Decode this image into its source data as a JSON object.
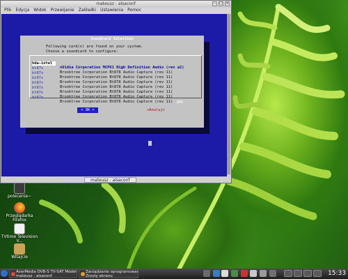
{
  "terminal": {
    "title": "mateusz : alsaconf",
    "menu": [
      "Plik",
      "Edycja",
      "Widok",
      "Przewijanie",
      "Zakładki",
      "Ustawienia",
      "Pomoc"
    ],
    "tab_label": "mateusz : alsaconf"
  },
  "dialog": {
    "title": "Soundcard Selection",
    "text_line1": "Following card(s) are found on your system.",
    "text_line2": "Choose a soundcard to configure:",
    "items": [
      {
        "id": "hda-intel",
        "desc": "nVidia Corporation MCP61 High Definition Audio (rev a2)"
      },
      {
        "id": "bt87x",
        "desc": "Brooktree Corporation Bt878 Audio Capture (rev 11)"
      },
      {
        "id": "bt87x",
        "desc": "Brooktree Corporation Bt878 Audio Capture (rev 11)"
      },
      {
        "id": "bt87x",
        "desc": "Brooktree Corporation Bt878 Audio Capture (rev 11)"
      },
      {
        "id": "bt87x",
        "desc": "Brooktree Corporation Bt878 Audio Capture (rev 11)"
      },
      {
        "id": "bt87x",
        "desc": "Brooktree Corporation Bt878 Audio Capture (rev 11)"
      },
      {
        "id": "bt87x",
        "desc": "Brooktree Corporation Bt878 Audio Capture (rev 11)"
      },
      {
        "id": "bt87x",
        "desc": "Brooktree Corporation Bt878 Audio Capture (rev 11)"
      }
    ],
    "ok_label": "< OK >",
    "cancel_label": "<Anuluj>",
    "scroll_percent": "80%"
  },
  "desktop_icons": [
    {
      "label": "polecenia~",
      "color": "#3b3b3b"
    },
    {
      "label": "Przeglądarka Firefox",
      "color": "#e87a1e"
    },
    {
      "label": "TVtime Television V...",
      "color": "#f2f2f2"
    },
    {
      "label": "Witajcie",
      "color": "#c8a45a"
    }
  ],
  "taskbar": {
    "tasks": [
      {
        "line1": "AverMedia DVB-S TV-SAT Model 203",
        "line2": "mateusz : alsaconf"
      },
      {
        "line1": "Zarządzanie oprogramowaniem",
        "line2": "Zrzuty ekranu"
      }
    ],
    "clock": "15:33"
  }
}
